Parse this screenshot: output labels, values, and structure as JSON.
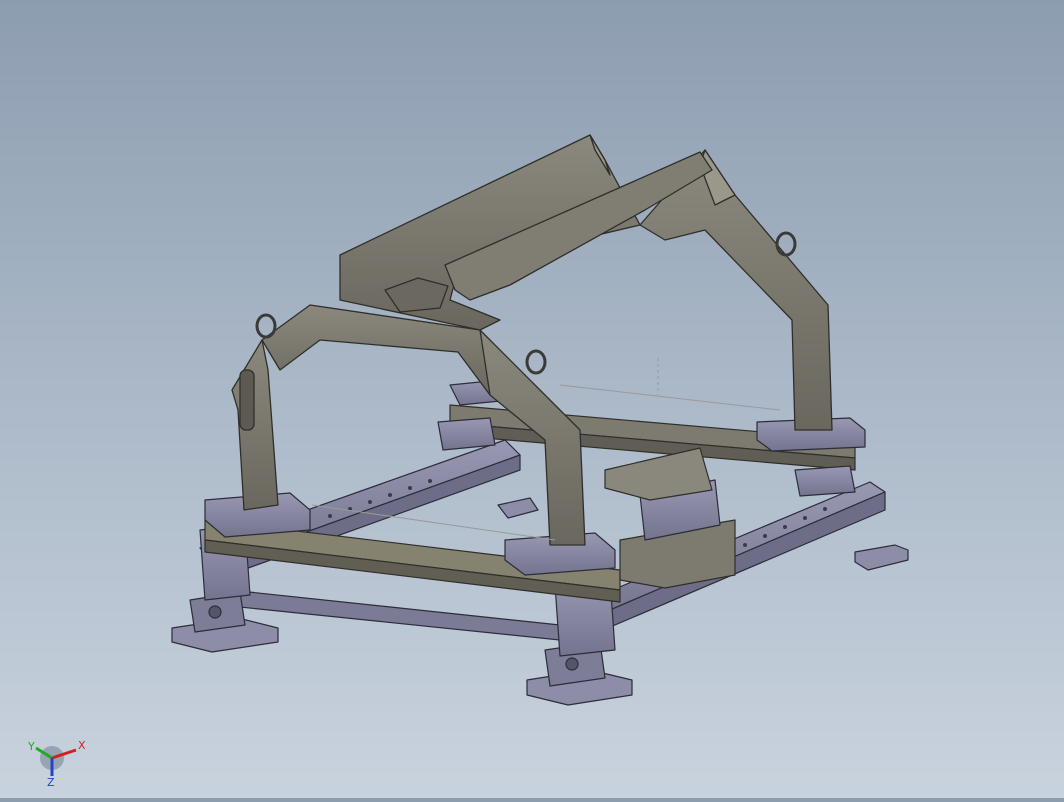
{
  "viewport": {
    "background_top": "#8d9db0",
    "background_bottom": "#c9d3de"
  },
  "model": {
    "frame_color": "#7a776d",
    "frame_edge": "#2f2f2a",
    "base_color": "#8a8aa6",
    "base_edge": "#2c2c3a",
    "ring_color": "#6e6d66"
  },
  "triad": {
    "x_label": "X",
    "y_label": "Y",
    "z_label": "Z",
    "x_color": "#cc2222",
    "y_color": "#22aa22",
    "z_color": "#2244cc"
  }
}
